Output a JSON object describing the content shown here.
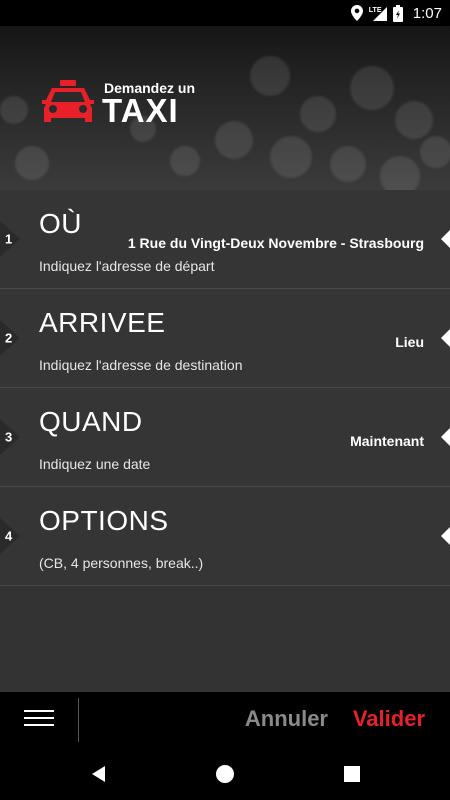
{
  "status_bar": {
    "time": "1:07",
    "network": "LTE"
  },
  "header": {
    "subtitle": "Demandez un",
    "title": "TAXI",
    "accent_color": "#e8202a"
  },
  "steps": [
    {
      "number": "1",
      "title": "OÙ",
      "subtitle": "Indiquez l'adresse de départ",
      "value": "1  Rue du Vingt-Deux Novembre - Strasbourg"
    },
    {
      "number": "2",
      "title": "ARRIVEE",
      "subtitle": "Indiquez l'adresse de destination",
      "value": "Lieu"
    },
    {
      "number": "3",
      "title": "QUAND",
      "subtitle": "Indiquez une date",
      "value": "Maintenant"
    },
    {
      "number": "4",
      "title": "OPTIONS",
      "subtitle": "(CB, 4 personnes, break..)",
      "value": ""
    }
  ],
  "actions": {
    "cancel_label": "Annuler",
    "validate_label": "Valider",
    "cancel_color": "#8a8a8a",
    "validate_color": "#e8202a"
  },
  "icons": {
    "menu": "hamburger-icon",
    "back": "back-triangle-icon",
    "home": "home-circle-icon",
    "recents": "recents-square-icon"
  }
}
